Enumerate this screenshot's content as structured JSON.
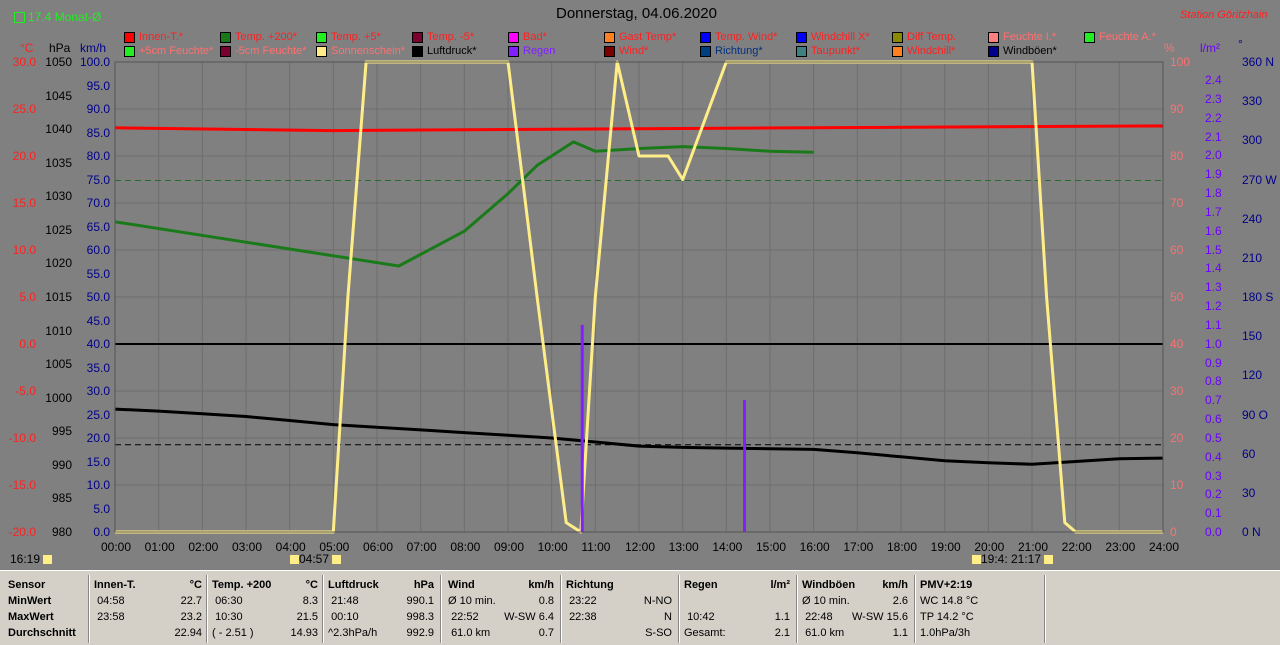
{
  "header": {
    "title": "Donnerstag, 04.06.2020",
    "station": "Station Göritzhain",
    "average_label": "17.4 Monat-Ø"
  },
  "axes": {
    "unit_celsius": "°C",
    "unit_hpa": "hPa",
    "unit_kmh": "km/h",
    "unit_percent": "%",
    "unit_lm2": "l/m²",
    "unit_deg": "°",
    "celsius_ticks": [
      "30.0",
      "25.0",
      "20.0",
      "15.0",
      "10.0",
      "5.0",
      "0.0",
      "-5.0",
      "-10.0",
      "-15.0",
      "-20.0"
    ],
    "hpa_ticks": [
      "1050",
      "1045",
      "1040",
      "1035",
      "1030",
      "1025",
      "1020",
      "1015",
      "1010",
      "1005",
      "1000",
      "995",
      "990",
      "985",
      "980"
    ],
    "kmh_ticks": [
      "100.0",
      "95.0",
      "90.0",
      "85.0",
      "80.0",
      "75.0",
      "70.0",
      "65.0",
      "60.0",
      "55.0",
      "50.0",
      "45.0",
      "40.0",
      "35.0",
      "30.0",
      "25.0",
      "20.0",
      "15.0",
      "10.0",
      "5.0",
      "0.0"
    ],
    "percent_ticks": [
      "100",
      "90",
      "80",
      "70",
      "60",
      "50",
      "40",
      "30",
      "20",
      "10",
      "0"
    ],
    "rain_ticks": [
      "2.4",
      "2.3",
      "2.2",
      "2.1",
      "2.0",
      "1.9",
      "1.8",
      "1.7",
      "1.6",
      "1.5",
      "1.4",
      "1.3",
      "1.2",
      "1.1",
      "1.0",
      "0.9",
      "0.8",
      "0.7",
      "0.6",
      "0.5",
      "0.4",
      "0.3",
      "0.2",
      "0.1",
      "0.0"
    ],
    "dir_ticks": [
      "360 N",
      "330",
      "300",
      "270 W",
      "240",
      "210",
      "180 S",
      "150",
      "120",
      "90 O",
      "60",
      "30",
      "0 N"
    ],
    "time_ticks": [
      "00:00",
      "01:00",
      "02:00",
      "03:00",
      "04:00",
      "05:00",
      "06:00",
      "07:00",
      "08:00",
      "09:00",
      "10:00",
      "11:00",
      "12:00",
      "13:00",
      "14:00",
      "15:00",
      "16:00",
      "17:00",
      "18:00",
      "19:00",
      "20:00",
      "21:00",
      "22:00",
      "23:00",
      "24:00"
    ]
  },
  "sun": {
    "now": "16:19",
    "sunrise": "04:57",
    "moonset": "19:4:",
    "sunset": "21:17"
  },
  "legend": [
    {
      "label": "Innen-T.*",
      "color": "#ff0000",
      "text": "#ff2020"
    },
    {
      "label": "Temp. +200*",
      "color": "#1a7a1a",
      "text": "#ff2020"
    },
    {
      "label": "Temp. +5*",
      "color": "#22ee22",
      "text": "#ff2020"
    },
    {
      "label": "Temp. -5*",
      "color": "#7a0030",
      "text": "#ff2020"
    },
    {
      "label": "Bad*",
      "color": "#ff00ff",
      "text": "#ff2020"
    },
    {
      "label": "Gast Temp*",
      "color": "#ff8020",
      "text": "#ff2020"
    },
    {
      "label": "Temp. Wind*",
      "color": "#0000ff",
      "text": "#ff2020"
    },
    {
      "label": "Windchill X*",
      "color": "#0000ff",
      "text": "#ff2020"
    },
    {
      "label": "Diff Temp.",
      "color": "#8a8a00",
      "text": "#ff2020"
    },
    {
      "label": "Feuchte I.*",
      "color": "#ff8080",
      "text": "#ff7070"
    },
    {
      "label": "Feuchte A.*",
      "color": "#22ee22",
      "text": "#ff7070"
    },
    {
      "label": "+5cm Feuchte*",
      "color": "#22ee22",
      "text": "#ff7070"
    },
    {
      "label": "-5cm Feuchte*",
      "color": "#7a0030",
      "text": "#ff7070"
    },
    {
      "label": "Sonnenschein*",
      "color": "#ffee88",
      "text": "#ff7070"
    },
    {
      "label": "Luftdruck*",
      "color": "#000000",
      "text": "#000000"
    },
    {
      "label": "Regen",
      "color": "#8020ff",
      "text": "#8020ff"
    },
    {
      "label": "Wind*",
      "color": "#7a0000",
      "text": "#ff2020"
    },
    {
      "label": "Richtung*",
      "color": "#004080",
      "text": "#003080"
    },
    {
      "label": "Taupunkt*",
      "color": "#408080",
      "text": "#ff2020"
    },
    {
      "label": "Windchill*",
      "color": "#ff8020",
      "text": "#ff2020"
    },
    {
      "label": "Windböen*",
      "color": "#00008b",
      "text": "#000000"
    }
  ],
  "colors": {
    "background": "#808080",
    "grid": "#6e6e6e",
    "sun": "#ffee88",
    "pressure": "#000000",
    "temp_inside": "#ff0000",
    "rain": "#8020ff",
    "humidity_out": "#22ee22",
    "wind_direction": "#1a4a9a"
  },
  "stats": {
    "sensor": {
      "h": "Sensor",
      "min": "MinWert",
      "max": "MaxWert",
      "avg": "Durchschnitt"
    },
    "innen": {
      "h": "Innen-T.",
      "u": "°C",
      "min_t": "04:58",
      "min_v": "22.7",
      "max_t": "23:58",
      "max_v": "23.2",
      "avg": "22.94"
    },
    "temp200": {
      "h": "Temp. +200",
      "u": "°C",
      "min_t": "06:30",
      "min_v": "8.3",
      "max_t": "10:30",
      "max_v": "21.5",
      "avg_t": "( - 2.51 )",
      "avg": "14.93"
    },
    "luftdruck": {
      "h": "Luftdruck",
      "u": "hPa",
      "min_t": "21:48",
      "min_v": "990.1",
      "max_t": "00:10",
      "max_v": "998.3",
      "avg_t": "^2.3hPa/h",
      "avg": "992.9"
    },
    "wind": {
      "h": "Wind",
      "u": "km/h",
      "min_t": "Ø 10 min.",
      "min_v": "0.8",
      "max_t": "22:52",
      "max_m": "W-SW 6.4",
      "avg_t": "61.0 km",
      "avg": "0.7"
    },
    "richtung": {
      "h": "Richtung",
      "u": "°",
      "min_t": "23:22",
      "min_v": "N-NO",
      "max_t": "22:38",
      "max_v": "N",
      "avg": "S-SO"
    },
    "regen": {
      "h": "Regen",
      "u": "l/m²",
      "max_t": "10:42",
      "max_v": "1.1",
      "avg_t": "Gesamt:",
      "avg": "2.1"
    },
    "windboeen": {
      "h": "Windböen",
      "u": "km/h",
      "min_t": "Ø 10 min.",
      "min_v": "2.6",
      "max_t": "22:48",
      "max_m": "W-SW 15.6",
      "avg_t": "61.0 km",
      "avg": "1.1"
    },
    "pmv": {
      "h": "PMV+2:19",
      "l1": "WC 14.8 °C",
      "l2": "TP 14.2 °C",
      "l3": "1.0hPa/3h"
    }
  },
  "chart_data": {
    "type": "line",
    "title": "Donnerstag, 04.06.2020",
    "xlabel": "",
    "ylabel": "°C",
    "x": [
      "00:00",
      "02:00",
      "04:00",
      "05:00",
      "06:00",
      "07:00",
      "08:00",
      "09:00",
      "09:30",
      "10:00",
      "10:40",
      "11:00",
      "12:00",
      "13:00",
      "14:00",
      "15:00",
      "16:00",
      "18:00",
      "20:00",
      "21:00",
      "22:00",
      "23:00",
      "24:00"
    ],
    "ylim": [
      -20,
      30
    ],
    "grid": true,
    "series": [
      {
        "name": "Luftdruck*",
        "axis": "hPa",
        "x": [
          "00:00",
          "01:00",
          "02:00",
          "03:00",
          "04:00",
          "05:00",
          "06:00",
          "07:00",
          "08:00",
          "09:00",
          "10:00",
          "11:00",
          "12:00",
          "13:00",
          "14:00",
          "15:00",
          "16:00",
          "17:00",
          "18:00",
          "19:00",
          "20:00",
          "21:00",
          "22:00",
          "23:00",
          "24:00"
        ],
        "values": [
          998.3,
          998.0,
          997.6,
          997.2,
          996.6,
          996.0,
          995.6,
          995.2,
          994.8,
          994.4,
          994.0,
          993.4,
          992.8,
          992.6,
          992.5,
          992.4,
          992.3,
          991.8,
          991.2,
          990.6,
          990.3,
          990.1,
          990.5,
          990.9,
          991.0
        ]
      },
      {
        "name": "Sonnenschein*",
        "axis": "percent",
        "x": [
          "00:00",
          "05:00",
          "05:20",
          "05:45",
          "06:00",
          "09:00",
          "09:40",
          "10:20",
          "10:40",
          "11:00",
          "11:30",
          "12:00",
          "12:40",
          "13:00",
          "14:00",
          "15:00",
          "21:00",
          "21:20",
          "21:45",
          "22:00",
          "24:00"
        ],
        "values": [
          0,
          0,
          50,
          100,
          100,
          100,
          50,
          2,
          0,
          50,
          100,
          80,
          80,
          75,
          100,
          100,
          100,
          50,
          2,
          0,
          0
        ]
      },
      {
        "name": "Innen-T.*",
        "axis": "°C",
        "x": [
          "00:00",
          "04:58",
          "12:00",
          "23:58",
          "24:00"
        ],
        "values": [
          23.0,
          22.7,
          22.9,
          23.2,
          23.1
        ]
      },
      {
        "name": "Temp. +200*",
        "axis": "°C",
        "x": [
          "00:00",
          "06:30",
          "08:00",
          "09:00",
          "09:40",
          "10:30",
          "11:00",
          "12:00",
          "13:00",
          "14:00",
          "15:00",
          "16:00"
        ],
        "values": [
          13.0,
          8.3,
          12.0,
          16.0,
          19.0,
          21.5,
          20.5,
          20.8,
          21.0,
          20.8,
          20.5,
          20.4
        ]
      },
      {
        "name": "Regen",
        "axis": "l/m²",
        "x": [
          "10:42",
          "14:25"
        ],
        "values": [
          1.1,
          0.7
        ]
      }
    ]
  }
}
